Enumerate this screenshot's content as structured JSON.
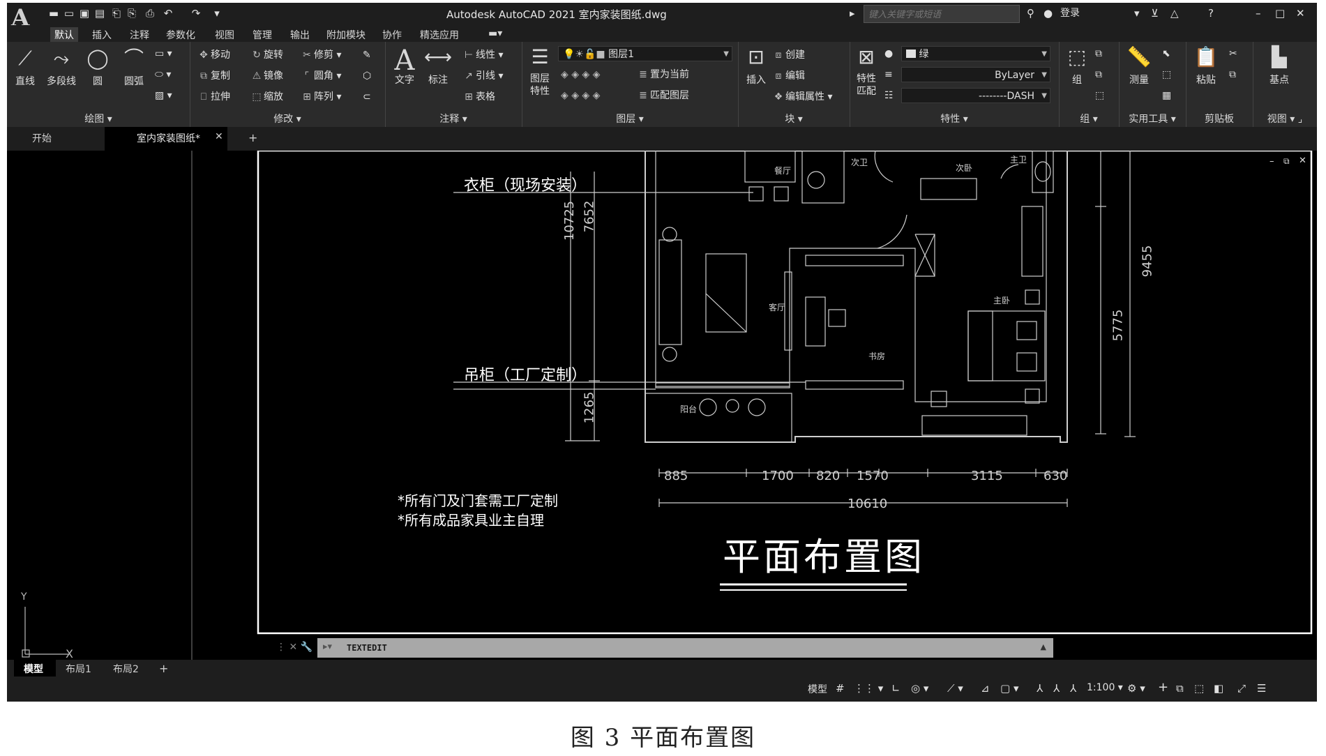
{
  "window": {
    "title": "Autodesk AutoCAD 2021    室内家装图纸.dwg",
    "search_placeholder": "键入关键字或短语",
    "login": "登录"
  },
  "ribbon_tabs": [
    "默认",
    "插入",
    "注释",
    "参数化",
    "视图",
    "管理",
    "输出",
    "附加模块",
    "协作",
    "精选应用"
  ],
  "ribbon": {
    "draw": {
      "title": "绘图",
      "line": "直线",
      "polyline": "多段线",
      "circle": "圆",
      "arc": "圆弧"
    },
    "modify": {
      "title": "修改",
      "move": "移动",
      "rotate": "旋转",
      "trim": "修剪",
      "copy": "复制",
      "mirror": "镜像",
      "fillet": "圆角",
      "stretch": "拉伸",
      "scale": "缩放",
      "array": "阵列"
    },
    "annotation": {
      "title": "注释",
      "text": "文字",
      "dimension": "标注",
      "linear": "线性",
      "leader": "引线",
      "table": "表格"
    },
    "layers": {
      "title": "图层",
      "layer_props": "图层\n特性",
      "current_layer": "图层1",
      "set_current": "置为当前",
      "match_layer": "匹配图层"
    },
    "block": {
      "title": "块",
      "insert": "插入",
      "create": "创建",
      "edit": "编辑",
      "edit_attr": "编辑属性"
    },
    "properties": {
      "title": "特性",
      "match": "特性\n匹配",
      "color": "绿",
      "lineweight": "ByLayer",
      "linetype": "--------DASH"
    },
    "groups": {
      "title": "组",
      "group": "组"
    },
    "utilities": {
      "title": "实用工具",
      "measure": "测量"
    },
    "clipboard": {
      "title": "剪贴板",
      "paste": "粘贴"
    },
    "view": {
      "title": "视图",
      "base": "基点"
    }
  },
  "file_tabs": {
    "start": "开始",
    "current": "室内家装图纸*"
  },
  "drawing": {
    "callout_wardrobe": "衣柜（现场安装）",
    "callout_cabinet": "吊柜（工厂定制）",
    "rooms": {
      "dining": "餐厅",
      "second_bath": "次卫",
      "second_bed": "次卧",
      "master_bath": "主卫",
      "living": "客厅",
      "master_bed": "主卧",
      "study": "书房",
      "balcony": "阳台"
    },
    "dims_left": [
      "10725",
      "7652",
      "1265"
    ],
    "dims_right": [
      "9455",
      "5775"
    ],
    "dims_bottom": [
      "885",
      "1700",
      "820",
      "1570",
      "3115",
      "630"
    ],
    "dim_total": "10610",
    "notes": [
      "*所有门及门套需工厂定制",
      "*所有成品家具业主自理"
    ],
    "plan_title": "平面布置图",
    "ucs_y": "Y",
    "ucs_x": "X"
  },
  "command_line": {
    "command": "TEXTEDIT"
  },
  "layout_tabs": [
    "模型",
    "布局1",
    "布局2"
  ],
  "status": {
    "model": "模型",
    "scale": "1:100"
  },
  "caption": "图 3    平面布置图",
  "colors": {
    "background": "#000000",
    "ribbon": "#2b2b2b",
    "titlebar": "#1e1e1e",
    "command_bar": "#a8a8a8"
  }
}
